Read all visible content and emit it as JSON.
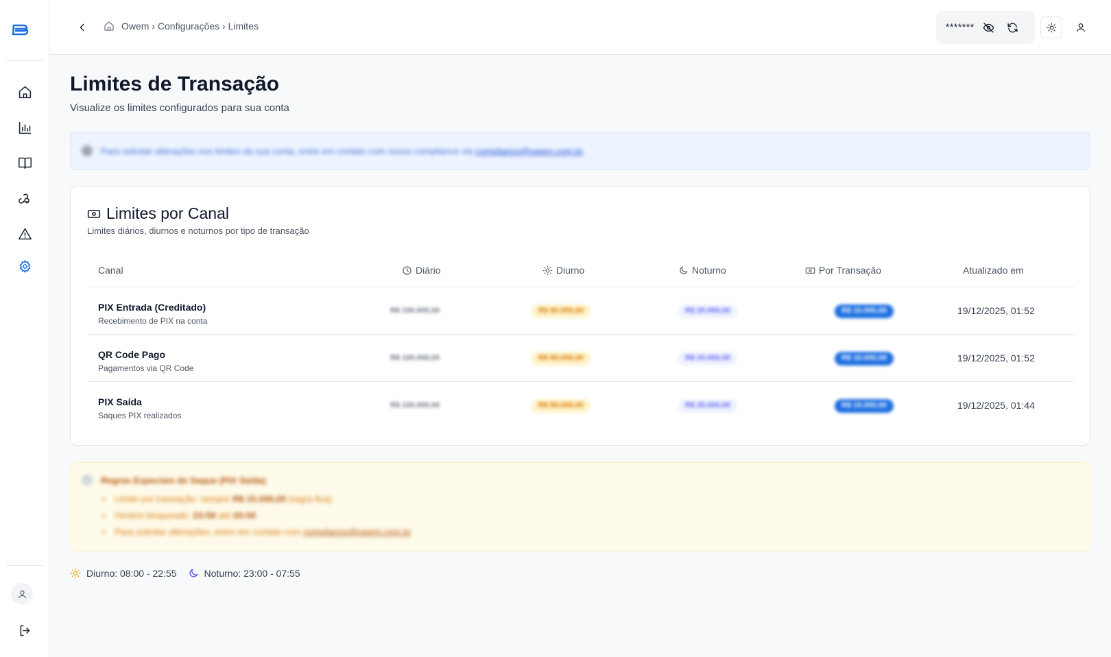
{
  "app": {
    "brand": "Owem"
  },
  "sidebar": {
    "items": [
      {
        "name": "home",
        "icon": "home-icon"
      },
      {
        "name": "reports",
        "icon": "bar-chart-icon"
      },
      {
        "name": "docs",
        "icon": "book-open-icon"
      },
      {
        "name": "webhooks",
        "icon": "webhook-icon"
      },
      {
        "name": "alerts",
        "icon": "alert-triangle-icon"
      },
      {
        "name": "settings",
        "icon": "gear-icon",
        "active": true
      }
    ],
    "footer": [
      {
        "name": "profile",
        "icon": "user-icon"
      },
      {
        "name": "logout",
        "icon": "logout-icon"
      }
    ]
  },
  "header": {
    "breadcrumb": "Owem › Configurações › Limites",
    "balance_masked": "*******"
  },
  "page": {
    "title": "Limites de Transação",
    "subtitle": "Visualize os limites configurados para sua conta"
  },
  "info_banner": {
    "text": "Para solicitar alterações nos limites da sua conta, entre em contato com nosso compliance via",
    "link": "compliance@owem.com.br"
  },
  "channels_card": {
    "title": "Limites por Canal",
    "subtitle": "Limites diários, diurnos e noturnos por tipo de transação",
    "columns": {
      "canal": "Canal",
      "diario": "Diário",
      "diurno": "Diurno",
      "noturno": "Noturno",
      "por_transacao": "Por Transação",
      "atualizado": "Atualizado em"
    },
    "rows": [
      {
        "name": "PIX Entrada (Creditado)",
        "desc": "Recebimento de PIX na conta",
        "diario": "R$ 100.000,00",
        "diurno": "R$ 80.000,00",
        "noturno": "R$ 20.000,00",
        "por_transacao": "R$ 10.000,00",
        "updated": "19/12/2025, 01:52"
      },
      {
        "name": "QR Code Pago",
        "desc": "Pagamentos via QR Code",
        "diario": "R$ 100.000,00",
        "diurno": "R$ 80.000,00",
        "noturno": "R$ 20.000,00",
        "por_transacao": "R$ 10.000,00",
        "updated": "19/12/2025, 01:52"
      },
      {
        "name": "PIX Saída",
        "desc": "Saques PIX realizados",
        "diario": "R$ 100.000,00",
        "diurno": "R$ 80.000,00",
        "noturno": "R$ 20.000,00",
        "por_transacao": "R$ 15.000,00",
        "updated": "19/12/2025, 01:44"
      }
    ]
  },
  "rules_banner": {
    "title": "Regras Especiais de Saque (PIX Saída)",
    "item1_prefix": "Limite por transação: sempre",
    "item1_strong": "R$ 15.000,00",
    "item1_suffix": "(regra fixa)",
    "item2_prefix": "Horário bloqueado:",
    "item2_start": "23:59",
    "item2_mid": "até",
    "item2_end": "00:00",
    "item3_prefix": "Para solicitar alterações, entre em contato com",
    "item3_link": "compliance@owem.com.br"
  },
  "legend": {
    "day": "Diurno: 08:00 - 22:55",
    "night": "Noturno: 23:00 - 07:55"
  },
  "colors": {
    "accent": "#1d6fe0",
    "day": "#f59e0b",
    "night": "#4f46e5"
  }
}
